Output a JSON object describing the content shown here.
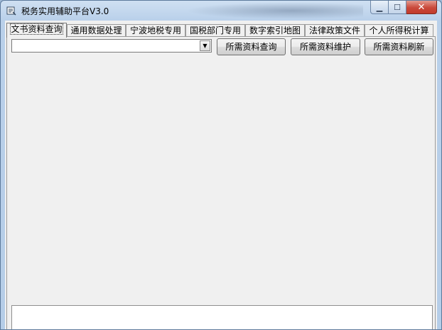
{
  "window": {
    "title": "税务实用辅助平台V3.0",
    "close_glyph": "✕",
    "min_glyph": "▁",
    "max_glyph": "☐"
  },
  "tabs": [
    {
      "label": "文书资料查询",
      "active": true
    },
    {
      "label": "通用数据处理",
      "active": false
    },
    {
      "label": "宁波地税专用",
      "active": false
    },
    {
      "label": "国税部门专用",
      "active": false
    },
    {
      "label": "数字索引地图",
      "active": false
    },
    {
      "label": "法律政策文件",
      "active": false
    },
    {
      "label": "个人所得税计算",
      "active": false
    }
  ],
  "query": {
    "combo_value": "",
    "dropdown_glyph": "▼"
  },
  "buttons": {
    "query_label": "所需资料查询",
    "maintain_label": "所需资料维护",
    "refresh_label": "所需资料刷新"
  },
  "output": {
    "text": ""
  },
  "colors": {
    "titlebar": "#b9d0ea",
    "client_bg": "#f0f0f0",
    "close_button": "#c9493a"
  }
}
